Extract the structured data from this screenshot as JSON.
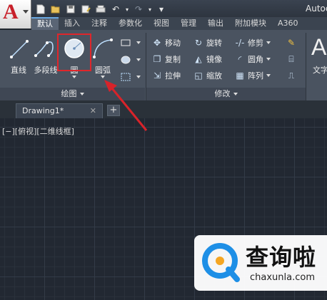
{
  "app": {
    "title": "Autoc"
  },
  "quick_access": {
    "icons": [
      "new-icon",
      "open-icon",
      "save-icon",
      "saveas-icon",
      "print-icon",
      "undo-icon",
      "redo-icon",
      "more-icon"
    ]
  },
  "ribbon_tabs": [
    {
      "label": "默认",
      "active": true
    },
    {
      "label": "插入"
    },
    {
      "label": "注释"
    },
    {
      "label": "参数化"
    },
    {
      "label": "视图"
    },
    {
      "label": "管理"
    },
    {
      "label": "输出"
    },
    {
      "label": "附加模块"
    },
    {
      "label": "A360"
    }
  ],
  "draw_panel": {
    "title": "绘图",
    "tools": {
      "line": "直线",
      "polyline": "多段线",
      "circle": "圆",
      "arc": "圆弧"
    }
  },
  "modify_panel": {
    "title": "修改",
    "tools": {
      "move": "移动",
      "rotate": "旋转",
      "trim": "修剪",
      "copy": "复制",
      "mirror": "镜像",
      "fillet": "圆角",
      "stretch": "拉伸",
      "scale": "缩放",
      "array": "阵列"
    }
  },
  "text_tool": {
    "label": "文字"
  },
  "document_tab": {
    "label": "Drawing1*",
    "close": "✕",
    "new": "+"
  },
  "viewport": {
    "label": "[−][俯视][二维线框]"
  },
  "watermark": {
    "title": "查询啦",
    "url": "chaxunla.com"
  },
  "colors": {
    "highlight": "#e0262b",
    "accent": "#6aa7e0",
    "annotation_arrow": "#d8232a"
  }
}
